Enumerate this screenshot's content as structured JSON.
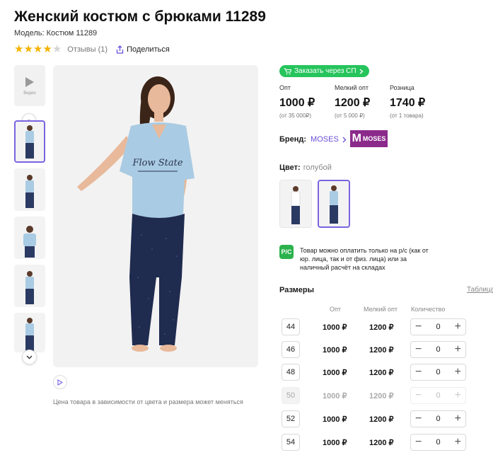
{
  "product": {
    "title": "Женский костюм с брюками 11289",
    "model": "Модель: Костюм 11289",
    "rating": 4,
    "reviews": "Отзывы (1)",
    "share": "Поделиться"
  },
  "gallery": {
    "video_label": "Видео",
    "price_note": "Цена товара в зависимости от цвета и размера может меняться"
  },
  "order_sp": "Заказать через СП",
  "prices": [
    {
      "label": "Опт",
      "value": "1000 ₽",
      "sub": "(от 35 000₽)"
    },
    {
      "label": "Мелкий опт",
      "value": "1200 ₽",
      "sub": "(от 5 000 ₽)"
    },
    {
      "label": "Розница",
      "value": "1740 ₽",
      "sub": "(от 1 товара)"
    }
  ],
  "brand": {
    "label": "Бренд:",
    "name": "MOSES",
    "logo_text": "MOSES",
    "logo_color": "#8b2a8b"
  },
  "color": {
    "label": "Цвет:",
    "value": "голубой"
  },
  "payment": {
    "icon_text": "Р/С",
    "text": "Товар можно оплатить только на р/с (как от юр. лица, так и от физ. лица) или за наличный расчёт на складах"
  },
  "sizes": {
    "title": "Размеры",
    "table_link": "Таблица",
    "headers": {
      "opt": "Опт",
      "small": "Мелкий опт",
      "qty": "Количество"
    },
    "rows": [
      {
        "size": "44",
        "opt": "1000 ₽",
        "small": "1200 ₽",
        "qty": "0"
      },
      {
        "size": "46",
        "opt": "1000 ₽",
        "small": "1200 ₽",
        "qty": "0"
      },
      {
        "size": "48",
        "opt": "1000 ₽",
        "small": "1200 ₽",
        "qty": "0"
      },
      {
        "size": "50",
        "opt": "1000 ₽",
        "small": "1200 ₽",
        "qty": "0"
      },
      {
        "size": "52",
        "opt": "1000 ₽",
        "small": "1200 ₽",
        "qty": "0"
      },
      {
        "size": "54",
        "opt": "1000 ₽",
        "small": "1200 ₽",
        "qty": "0"
      }
    ]
  },
  "colors": {
    "accent": "#6b4fd8",
    "green": "#26c45c",
    "star": "#f5b301"
  }
}
